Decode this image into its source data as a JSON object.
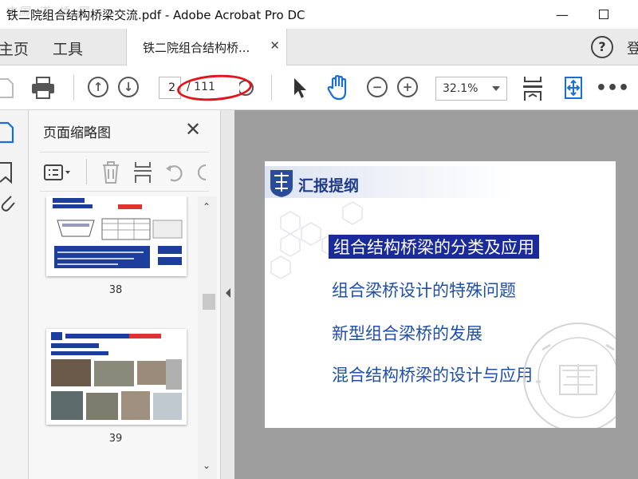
{
  "window": {
    "title": "铁二院组合结构桥梁交流.pdf - Adobe Acrobat Pro DC",
    "watermark": "中国·道·桥·网"
  },
  "nav": {
    "home": "主页",
    "tools": "工具",
    "doc_tab": "铁二院组合结构桥...",
    "help": "?",
    "signin": "登"
  },
  "toolbar": {
    "page_current": "2",
    "page_total": "/ 111",
    "zoom": "32.1%"
  },
  "panel": {
    "title": "页面缩略图",
    "thumbnails": [
      {
        "page": "38"
      },
      {
        "page": "39"
      }
    ]
  },
  "slide": {
    "title": "汇报提纲",
    "items": [
      "组合结构桥梁的分类及应用",
      "组合梁桥设计的特殊问题",
      "新型组合梁桥的发展",
      "混合结构桥梁的设计与应用"
    ]
  },
  "colors": {
    "annotation": "#e0141b",
    "slide_text": "#1f4fa6",
    "slide_highlight": "#1a2a9a",
    "title_blue": "#1f3a8a"
  }
}
